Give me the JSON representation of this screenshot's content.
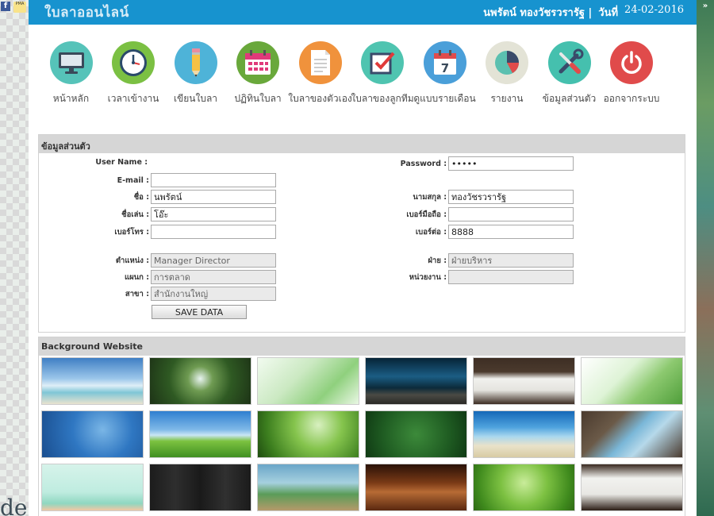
{
  "page": {
    "app_title": "ใบลาออนไลน์",
    "user_name": "นพรัตน์ ทองวัชรวรารัฐ |",
    "date_label": "วันที่",
    "date_value": "24-02-2016",
    "fb_label": "f",
    "pma_label": "PMA",
    "right_arrows": "»",
    "bottom_text": "de"
  },
  "menu": [
    {
      "label": "หน้าหลัก",
      "icon": "monitor-icon",
      "color": "#56c3b9"
    },
    {
      "label": "เวลาเข้างาน",
      "icon": "clock-icon",
      "color": "#7bc043"
    },
    {
      "label": "เขียนใบลา",
      "icon": "pencil-icon",
      "color": "#4eb3d8"
    },
    {
      "label": "ปฏิทินใบลา",
      "icon": "calendar-icon",
      "color": "#69a83b"
    },
    {
      "label": "ใบลาของตัวเอง",
      "icon": "document-icon",
      "color": "#f0923c"
    },
    {
      "label": "ใบลาของลูกทีม",
      "icon": "checkbox-icon",
      "color": "#4fc4b0"
    },
    {
      "label": "ดูแบบรายเดือน",
      "icon": "calendar-day-icon",
      "color": "#4a9fd9"
    },
    {
      "label": "รายงาน",
      "icon": "pie-chart-icon",
      "color": "#e3e3d6"
    },
    {
      "label": "ข้อมูลส่วนตัว",
      "icon": "tools-icon",
      "color": "#45c0ae"
    },
    {
      "label": "ออกจากระบบ",
      "icon": "power-icon",
      "color": "#e04b4b"
    }
  ],
  "profile": {
    "title": "ข้อมูลส่วนตัว",
    "username_label": "User Name :",
    "username_value": "",
    "password_label": "Password :",
    "password_value": "•••••",
    "email_label": "E-mail :",
    "email_value": "",
    "firstname_label": "ชื่อ :",
    "firstname_value": "นพรัตน์",
    "lastname_label": "นามสกุล :",
    "lastname_value": "ทองวัชรวรารัฐ",
    "nickname_label": "ชื่อเล่น :",
    "nickname_value": "โอ๊ะ",
    "mobile_label": "เบอร์มือถือ :",
    "mobile_value": "",
    "phone_label": "เบอร์โทร :",
    "phone_value": "",
    "ext_label": "เบอร์ต่อ :",
    "ext_value": "8888",
    "position_label": "ตำแหน่ง :",
    "position_value": "Manager Director",
    "division_label": "ฝ่าย :",
    "division_value": "ฝ่ายบริหาร",
    "department_label": "แผนก :",
    "department_value": "การตลาด",
    "unit_label": "หน่วยงาน :",
    "unit_value": "",
    "branch_label": "สาขา :",
    "branch_value": "สำนักงานใหญ่",
    "save_label": "SAVE DATA"
  },
  "backgrounds": {
    "title": "Background Website",
    "thumbnails": [
      {
        "name": "beach-sky",
        "gradient": "linear-gradient(180deg,#3f7fc4 0%,#9cc7ea 45%,#dfeef7 60%,#7fc6d6 75%,#e9e3d0 100%)"
      },
      {
        "name": "waterfall-forest",
        "gradient": "radial-gradient(circle at 50% 45%,#e8f4f0 0%,#6f9b52 22%,#2f5a23 55%,#1d3316 100%)"
      },
      {
        "name": "green-light",
        "gradient": "linear-gradient(135deg,#f2fbf0 0%,#cbe9c2 40%,#8fd07d 70%,#e9f7e4 100%)"
      },
      {
        "name": "bokeh-wood",
        "gradient": "linear-gradient(180deg,#062437 0%,#1b5d84 40%,#0c2a3a 65%,#4a4a44 80%,#2b2a26 100%)"
      },
      {
        "name": "desk-laptop",
        "gradient": "linear-gradient(180deg,#3d2e24 0%,#4b3a2d 30%,#f1f1ee 45%,#e5e4df 70%,#3c2c22 100%)"
      },
      {
        "name": "green-leaves",
        "gradient": "linear-gradient(135deg,#ffffff 0%,#def3d6 40%,#8cc96f 65%,#4f9e3a 100%)"
      },
      {
        "name": "water-drops",
        "gradient": "radial-gradient(circle at 60% 40%,#7ab6e6 0%,#2f77c2 45%,#1a4e8f 100%)"
      },
      {
        "name": "green-meadow",
        "gradient": "linear-gradient(180deg,#2f7fd0 0%,#7fb9e8 40%,#c9e6f5 52%,#7cc240 65%,#3f8f21 100%)"
      },
      {
        "name": "sprouts",
        "gradient": "radial-gradient(circle at 60% 30%,#d8f0c0 0%,#85c44d 35%,#3d7f1f 75%,#1f4c10 100%)"
      },
      {
        "name": "green-texture",
        "gradient": "radial-gradient(circle at 50% 50%,#3c8a3a 0%,#1f5c22 60%,#103a14 100%)"
      },
      {
        "name": "tropical-beach",
        "gradient": "linear-gradient(180deg,#1568b8 0%,#4fa3de 35%,#a9d7ee 55%,#e9e2c9 75%,#d8cba4 100%)"
      },
      {
        "name": "desk-tablet",
        "gradient": "linear-gradient(135deg,#4a3a2e 0%,#6b5a48 30%,#7ab7d8 50%,#b6d9ea 65%,#4a3a2e 100%)"
      },
      {
        "name": "spring-illustration",
        "gradient": "linear-gradient(180deg,#d6f3ea 0%,#bfece0 60%,#8fd7c0 85%,#f3c7a3 100%)"
      },
      {
        "name": "dark-wood",
        "gradient": "linear-gradient(90deg,#1c1c1c 0%,#2e2e2e 25%,#1a1a1a 50%,#303030 75%,#1b1b1b 100%)"
      },
      {
        "name": "floating-islands",
        "gradient": "linear-gradient(180deg,#6aa6c8 0%,#a6d0df 40%,#5a9c58 65%,#b59a6a 100%)"
      },
      {
        "name": "wood-lights",
        "gradient": "linear-gradient(180deg,#2a1208 0%,#7a3a16 40%,#b76b35 60%,#5a2810 100%)"
      },
      {
        "name": "green-bokeh-leaves",
        "gradient": "radial-gradient(circle at 50% 40%,#c9ec9a 0%,#7dc142 40%,#3f8a1d 80%,#2f6a14 100%)"
      },
      {
        "name": "desk-papers",
        "gradient": "linear-gradient(180deg,#3a2a20 0%,#f2f2ef 30%,#e8e7e3 65%,#2c1e16 100%)"
      }
    ]
  }
}
